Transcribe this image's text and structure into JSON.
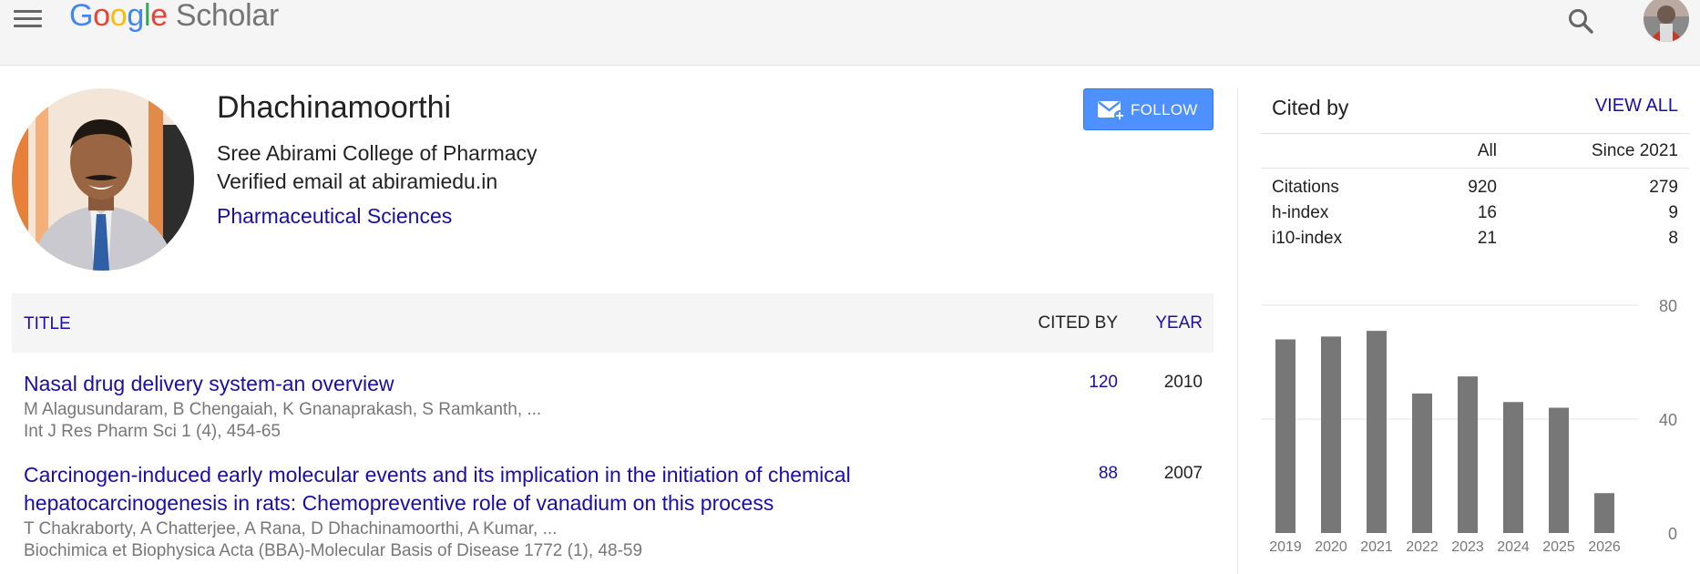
{
  "header": {
    "logo": {
      "g1": "G",
      "g2": "o",
      "g3": "o",
      "g4": "g",
      "g5": "l",
      "g6": "e",
      "product": "Scholar"
    },
    "icons": {
      "menu": "menu-icon",
      "search": "search-icon",
      "account": "account-avatar"
    }
  },
  "profile": {
    "name": "Dhachinamoorthi",
    "affiliation": "Sree Abirami College of Pharmacy",
    "email": "Verified email at abiramiedu.in",
    "interests": [
      "Pharmaceutical Sciences"
    ],
    "follow_label": "FOLLOW"
  },
  "articles": {
    "headers": {
      "title": "TITLE",
      "cited_by": "CITED BY",
      "year": "YEAR"
    },
    "rows": [
      {
        "title": "Nasal drug delivery system-an overview",
        "authors": "M Alagusundaram, B Chengaiah, K Gnanaprakash, S Ramkanth, ...",
        "venue": "Int J Res Pharm Sci 1 (4), 454-65",
        "cited_by": "120",
        "year": "2010"
      },
      {
        "title": "Carcinogen-induced early molecular events and its implication in the initiation of chemical hepatocarcinogenesis in rats: Chemopreventive role of vanadium on this process",
        "authors": "T Chakraborty, A Chatterjee, A Rana, D Dhachinamoorthi, A Kumar, ...",
        "venue": "Biochimica et Biophysica Acta (BBA)-Molecular Basis of Disease 1772 (1), 48-59",
        "cited_by": "88",
        "year": "2007"
      }
    ]
  },
  "cited_by": {
    "title": "Cited by",
    "view_all": "VIEW ALL",
    "columns": {
      "all": "All",
      "since": "Since 2021"
    },
    "stats": [
      {
        "label": "Citations",
        "all": "920",
        "since": "279"
      },
      {
        "label": "h-index",
        "all": "16",
        "since": "9"
      },
      {
        "label": "i10-index",
        "all": "21",
        "since": "8"
      }
    ]
  },
  "colors": {
    "link": "#1a0dab",
    "bar": "#777777",
    "follow": "#4d90fe",
    "grid": "#e6e6e6"
  },
  "chart_data": {
    "type": "bar",
    "categories": [
      "2019",
      "2020",
      "2021",
      "2022",
      "2023",
      "2024",
      "2025",
      "2026"
    ],
    "values": [
      68,
      69,
      71,
      49,
      55,
      46,
      44,
      14
    ],
    "ylim": [
      0,
      80
    ],
    "yticks": [
      "0",
      "40",
      "80"
    ],
    "y_axis_side": "right",
    "grid": true
  }
}
